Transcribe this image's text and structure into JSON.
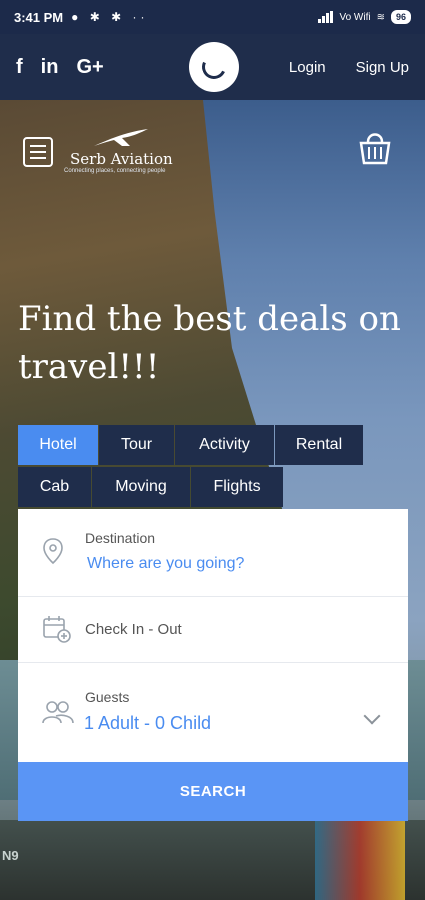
{
  "status_bar": {
    "time": "3:41 PM",
    "notification_icons": [
      "whatsapp-icon",
      "bluetooth-icon",
      "bluetooth-icon",
      "more-icon"
    ],
    "network_label": "Vo Wifi",
    "battery": "96"
  },
  "topnav": {
    "social": [
      "f",
      "in",
      "G+"
    ],
    "login": "Login",
    "signup": "Sign Up"
  },
  "brand": {
    "name": "Serb Aviation",
    "tagline": "Connecting places, connecting people"
  },
  "hero": {
    "headline": "Find the best deals on travel!!!",
    "boat_text": "N9"
  },
  "tabs": [
    "Hotel",
    "Tour",
    "Activity",
    "Rental",
    "Cab",
    "Moving",
    "Flights"
  ],
  "active_tab": "Hotel",
  "form": {
    "destination_label": "Destination",
    "destination_placeholder": "Where are you going?",
    "dates_label": "Check In - Out",
    "guests_label": "Guests",
    "guests_value": "1 Adult - 0 Child",
    "search_label": "SEARCH"
  },
  "colors": {
    "navy": "#1f2d4b",
    "accent": "#4a8cf0",
    "search": "#5a95f5"
  }
}
